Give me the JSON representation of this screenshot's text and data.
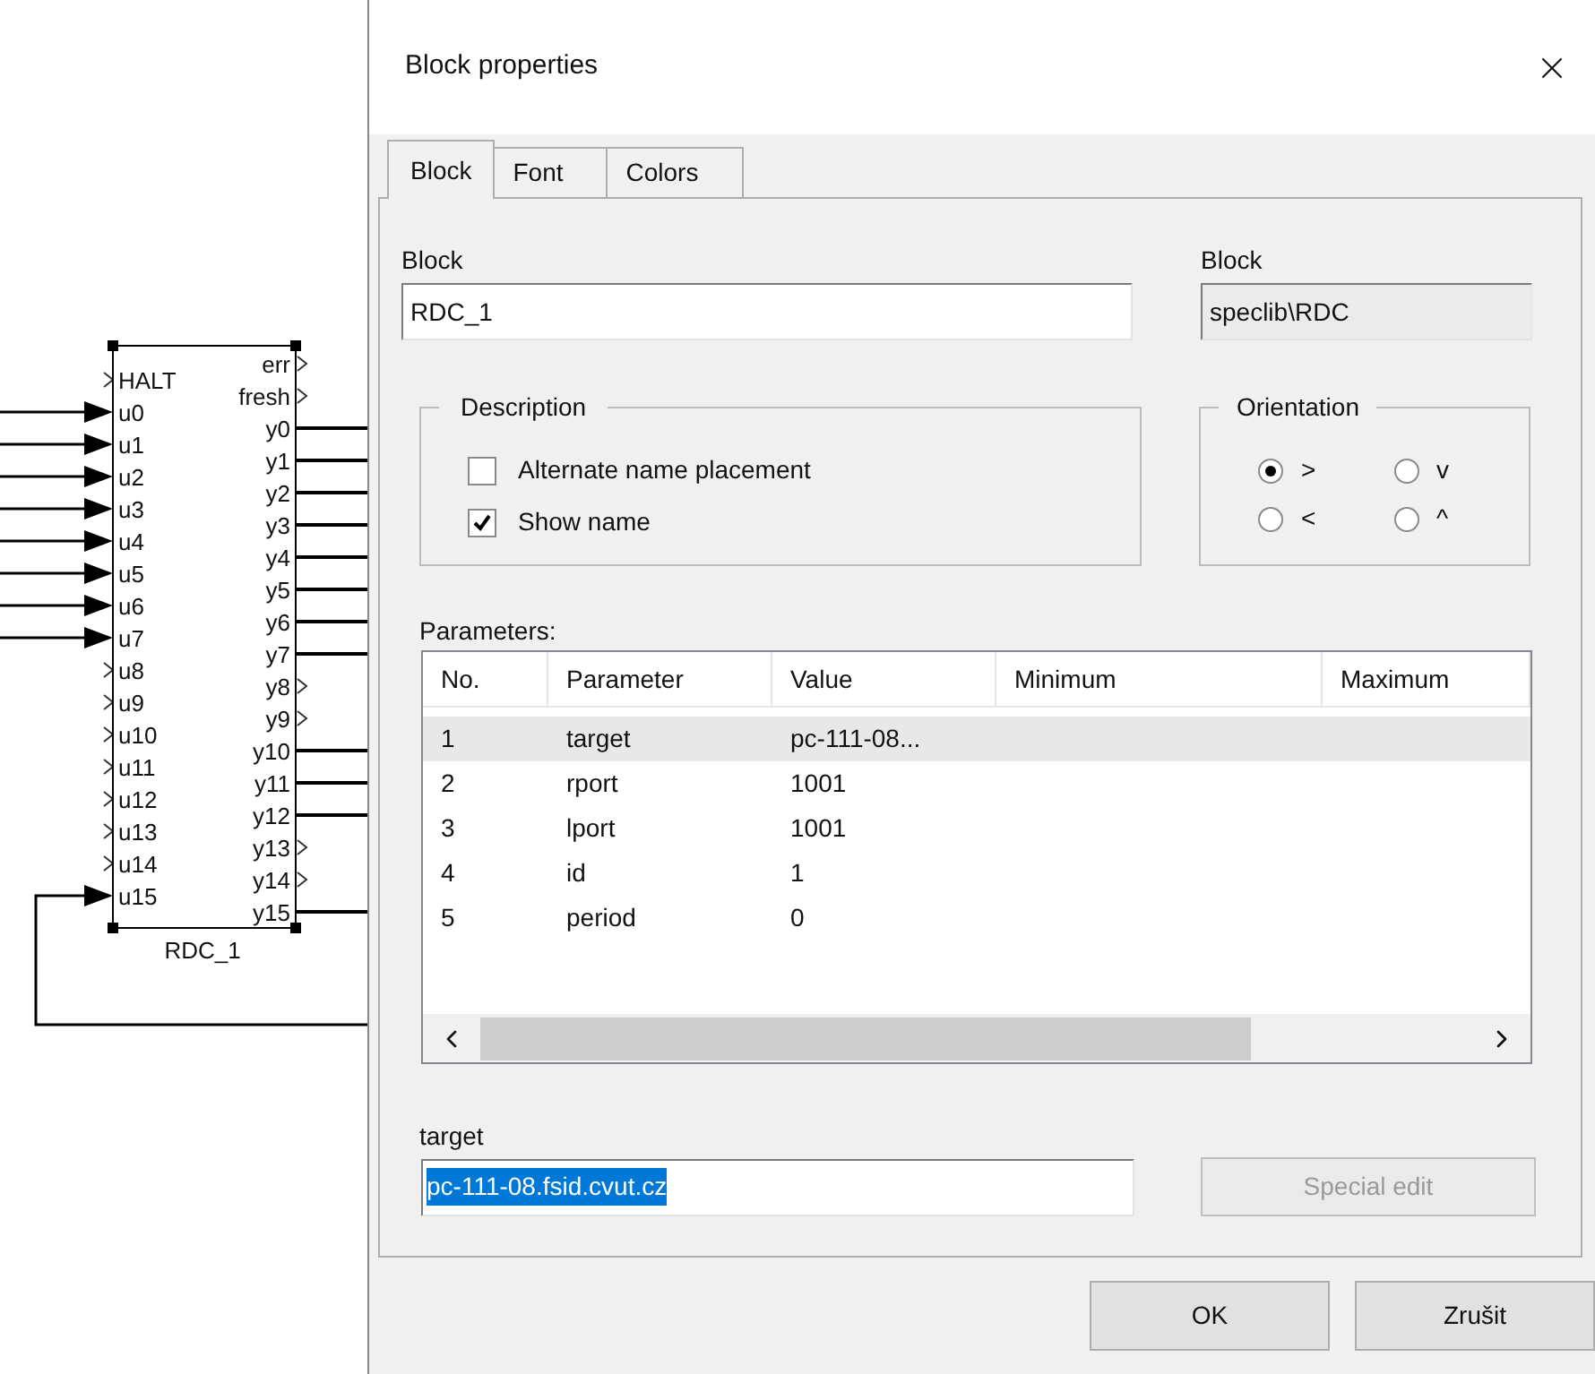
{
  "canvas": {
    "block": {
      "name": "RDC_1",
      "inputs": [
        {
          "label": "HALT",
          "connected": false
        },
        {
          "label": "u0",
          "connected": true
        },
        {
          "label": "u1",
          "connected": true
        },
        {
          "label": "u2",
          "connected": true
        },
        {
          "label": "u3",
          "connected": true
        },
        {
          "label": "u4",
          "connected": true
        },
        {
          "label": "u5",
          "connected": true
        },
        {
          "label": "u6",
          "connected": true
        },
        {
          "label": "u7",
          "connected": true
        },
        {
          "label": "u8",
          "connected": false
        },
        {
          "label": "u9",
          "connected": false
        },
        {
          "label": "u10",
          "connected": false
        },
        {
          "label": "u11",
          "connected": false
        },
        {
          "label": "u12",
          "connected": false
        },
        {
          "label": "u13",
          "connected": false
        },
        {
          "label": "u14",
          "connected": false
        },
        {
          "label": "u15",
          "connected": true
        }
      ],
      "outputs": [
        {
          "label": "err",
          "connected": false
        },
        {
          "label": "fresh",
          "connected": false
        },
        {
          "label": "y0",
          "connected": true
        },
        {
          "label": "y1",
          "connected": true
        },
        {
          "label": "y2",
          "connected": true
        },
        {
          "label": "y3",
          "connected": true
        },
        {
          "label": "y4",
          "connected": true
        },
        {
          "label": "y5",
          "connected": true
        },
        {
          "label": "y6",
          "connected": true
        },
        {
          "label": "y7",
          "connected": true
        },
        {
          "label": "y8",
          "connected": false
        },
        {
          "label": "y9",
          "connected": false
        },
        {
          "label": "y10",
          "connected": true
        },
        {
          "label": "y11",
          "connected": true
        },
        {
          "label": "y12",
          "connected": true
        },
        {
          "label": "y13",
          "connected": false
        },
        {
          "label": "y14",
          "connected": false
        },
        {
          "label": "y15",
          "connected": true
        }
      ]
    }
  },
  "dialog": {
    "title": "Block properties",
    "tabs": [
      {
        "label": "Block",
        "selected": true
      },
      {
        "label": "Font",
        "selected": false
      },
      {
        "label": "Colors",
        "selected": false
      }
    ],
    "block_name": {
      "label": "Block",
      "value": "RDC_1"
    },
    "block_type": {
      "label": "Block",
      "value": "speclib\\RDC"
    },
    "description": {
      "title": "Description",
      "options": [
        {
          "label": "Alternate name placement",
          "checked": false
        },
        {
          "label": "Show name",
          "checked": true
        }
      ]
    },
    "orientation": {
      "title": "Orientation",
      "options": [
        {
          "label": ">",
          "selected": true
        },
        {
          "label": "v",
          "selected": false
        },
        {
          "label": "<",
          "selected": false
        },
        {
          "label": "^",
          "selected": false
        }
      ]
    },
    "parameters": {
      "label": "Parameters:",
      "columns": [
        "No.",
        "Parameter",
        "Value",
        "Minimum",
        "Maximum"
      ],
      "rows": [
        {
          "cells": [
            "1",
            "target",
            "pc-111-08..."
          ],
          "selected": true
        },
        {
          "cells": [
            "2",
            "rport",
            "1001"
          ],
          "selected": false
        },
        {
          "cells": [
            "3",
            "lport",
            "1001"
          ],
          "selected": false
        },
        {
          "cells": [
            "4",
            "id",
            "1"
          ],
          "selected": false
        },
        {
          "cells": [
            "5",
            "period",
            "0"
          ],
          "selected": false
        }
      ]
    },
    "edit": {
      "label": "target",
      "value": "pc-111-08.fsid.cvut.cz",
      "value_selected": true
    },
    "special_edit": {
      "label": "Special edit",
      "disabled": true
    },
    "buttons": [
      "OK",
      "Zrušit"
    ]
  }
}
